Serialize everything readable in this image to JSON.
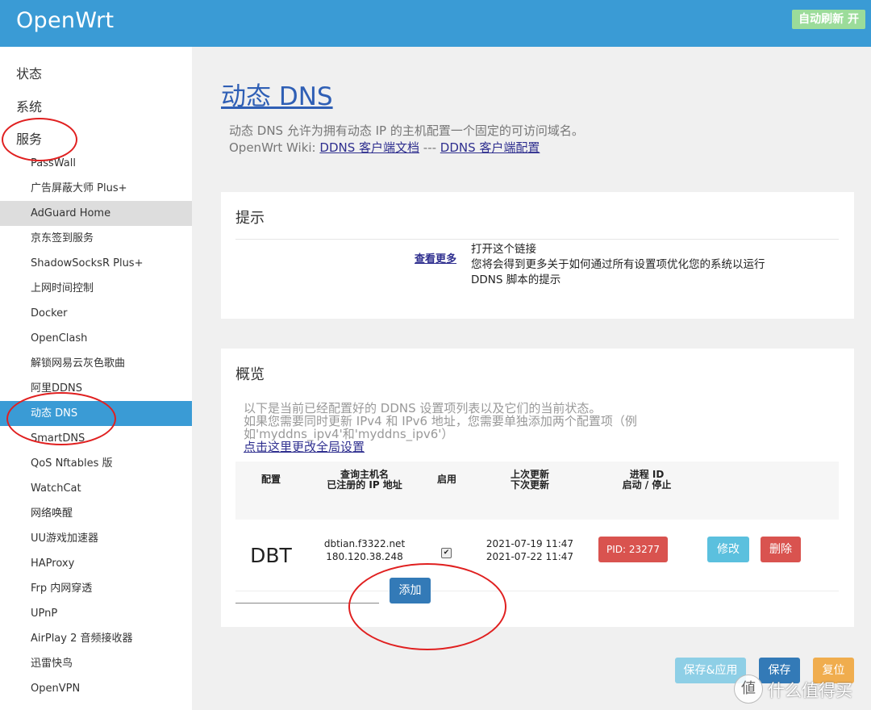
{
  "header": {
    "brand": "OpenWrt",
    "refresh_label": "自动刷新 开"
  },
  "sidebar": {
    "top": [
      "状态",
      "系统",
      "服务"
    ],
    "items": [
      {
        "label": "PassWall"
      },
      {
        "label": "广告屏蔽大师 Plus+"
      },
      {
        "label": "AdGuard Home",
        "state": "hover"
      },
      {
        "label": "京东签到服务"
      },
      {
        "label": "ShadowSocksR Plus+"
      },
      {
        "label": "上网时间控制"
      },
      {
        "label": "Docker"
      },
      {
        "label": "OpenClash"
      },
      {
        "label": "解锁网易云灰色歌曲"
      },
      {
        "label": "阿里DDNS"
      },
      {
        "label": "动态 DNS",
        "state": "active"
      },
      {
        "label": "SmartDNS"
      },
      {
        "label": "QoS Nftables 版"
      },
      {
        "label": "WatchCat"
      },
      {
        "label": "网络唤醒"
      },
      {
        "label": "UU游戏加速器"
      },
      {
        "label": "HAProxy"
      },
      {
        "label": "Frp 内网穿透"
      },
      {
        "label": "UPnP"
      },
      {
        "label": "AirPlay 2 音频接收器"
      },
      {
        "label": "迅雷快鸟"
      },
      {
        "label": "OpenVPN"
      }
    ]
  },
  "page": {
    "title": "动态 DNS",
    "desc_line1": "动态 DNS 允许为拥有动态 IP 的主机配置一个固定的可访问域名。",
    "desc_wiki": "OpenWrt Wiki: ",
    "desc_link1": "DDNS 客户端文档",
    "desc_sep": " --- ",
    "desc_link2": "DDNS 客户端配置"
  },
  "hint": {
    "title": "提示",
    "link": "查看更多",
    "text_line1": "打开这个链接",
    "text_line2": "您将会得到更多关于如何通过所有设置项优化您的系统以运行",
    "text_line3": "DDNS 脚本的提示"
  },
  "overview": {
    "title": "概览",
    "desc_line1": "以下是当前已经配置好的 DDNS 设置项列表以及它们的当前状态。",
    "desc_line2": "如果您需要同时更新 IPv4 和 IPv6 地址，您需要单独添加两个配置项（例",
    "desc_line3": "如'myddns_ipv4'和'myddns_ipv6'）",
    "global_link": "点击这里更改全局设置",
    "columns": {
      "config": "配置",
      "host_1": "查询主机名",
      "host_2": "已注册的 IP 地址",
      "enabled": "启用",
      "update_1": "上次更新",
      "update_2": "下次更新",
      "pid_1": "进程 ID",
      "pid_2": "启动 / 停止"
    },
    "row": {
      "name": "DBT",
      "host": "dbtian.f3322.net",
      "ip": "180.120.38.248",
      "enabled": true,
      "last_update": "2021-07-19 11:47",
      "next_update": "2021-07-22 11:47",
      "pid": "PID: 23277",
      "edit": "修改",
      "delete": "删除"
    },
    "add": "添加"
  },
  "footer": {
    "save_apply": "保存&应用",
    "save": "保存",
    "reset": "复位"
  },
  "watermark": "什么值得买",
  "colors": {
    "header": "#3a9bd5",
    "active": "#3a9bd5",
    "danger": "#d9534f",
    "info": "#5bc0de",
    "primary": "#337ab7",
    "warning": "#f0ad4e"
  }
}
